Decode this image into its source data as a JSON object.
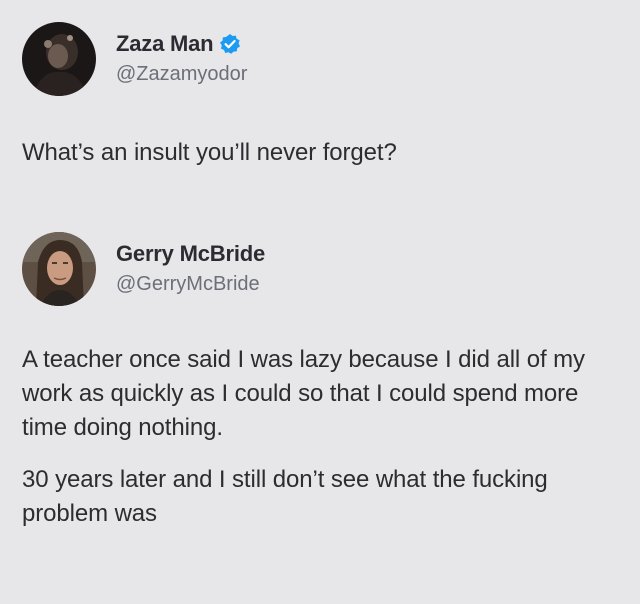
{
  "posts": [
    {
      "author": {
        "display_name": "Zaza Man",
        "handle": "@Zazamyodor",
        "verified": true,
        "avatar_icon": "user-avatar-dark"
      },
      "text": [
        "What’s an insult you’ll never forget?"
      ]
    },
    {
      "author": {
        "display_name": "Gerry McBride",
        "handle": "@GerryMcBride",
        "verified": false,
        "avatar_icon": "user-avatar-photo"
      },
      "text": [
        "A teacher once said I was lazy because I did all of my work as quickly as I could so that I could spend more time doing nothing.",
        "30 years later and I still don’t see what the fucking problem was"
      ]
    }
  ],
  "colors": {
    "background": "#e7e7ea",
    "text": "#2c2c31",
    "handle": "#6c6f78",
    "verified_badge": "#1d9bf0"
  }
}
